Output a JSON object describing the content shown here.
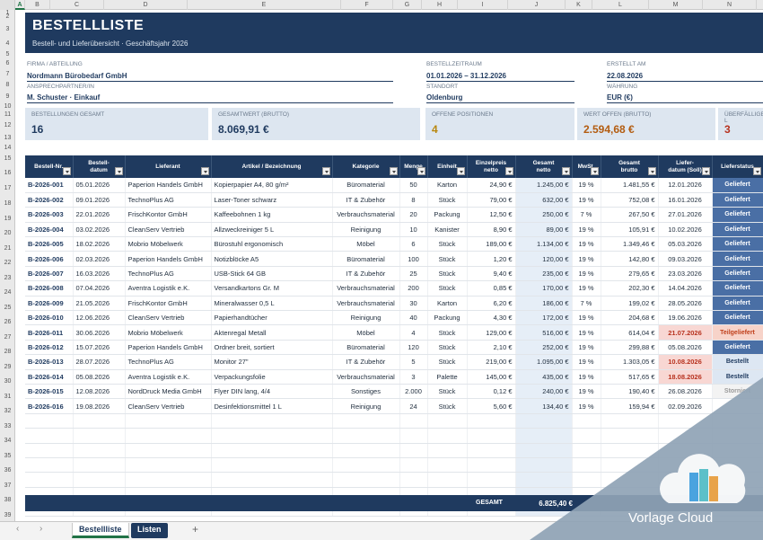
{
  "sheet": {
    "title": "BESTELLLISTE",
    "subtitle": "Bestell- und Lieferübersicht · Geschäftsjahr 2026"
  },
  "columns": [
    "A",
    "B",
    "C",
    "D",
    "E",
    "F",
    "G",
    "H",
    "I",
    "J",
    "K",
    "L",
    "M",
    "N"
  ],
  "rows": [
    "1",
    "2",
    "3",
    "4",
    "5",
    "6",
    "7",
    "8",
    "9",
    "10",
    "11",
    "12",
    "13",
    "14",
    "15",
    "16",
    "17",
    "18",
    "19",
    "20",
    "21",
    "22",
    "23",
    "24",
    "25",
    "26",
    "27",
    "28",
    "29",
    "30",
    "31",
    "32",
    "33",
    "34",
    "35",
    "36",
    "37",
    "38",
    "39"
  ],
  "info": {
    "firma_label": "FIRMA / ABTEILUNG",
    "firma": "Nordmann Bürobedarf GmbH",
    "ansprech_label": "ANSPRECHPARTNER/IN",
    "ansprech": "M. Schuster · Einkauf",
    "zeitraum_label": "BESTELLZEITRAUM",
    "zeitraum": "01.01.2026 – 31.12.2026",
    "standort_label": "STANDORT",
    "standort": "Oldenburg",
    "erstellt_label": "ERSTELLT AM",
    "erstellt": "22.08.2026",
    "waehrung_label": "WÄHRUNG",
    "waehrung": "EUR (€)"
  },
  "kpis": [
    {
      "label": "BESTELLUNGEN GESAMT",
      "value": "16",
      "color": "#1f3a5f"
    },
    {
      "label": "GESAMTWERT (BRUTTO)",
      "value": "8.069,91 €",
      "color": "#1f3a5f"
    },
    {
      "label": "OFFENE POSITIONEN",
      "value": "4",
      "color": "#b8860b"
    },
    {
      "label": "WERT OFFEN (BRUTTO)",
      "value": "2.594,68 €",
      "color": "#b35c10"
    },
    {
      "label": "ÜBERFÄLLIGE L",
      "value": "3",
      "color": "#b7321f"
    }
  ],
  "headers": [
    "Bestell-Nr.",
    "Bestell-\ndatum",
    "Lieferant",
    "Artikel / Bezeichnung",
    "Kategorie",
    "Menge",
    "Einheit",
    "Einzelpreis\nnetto",
    "Gesamt\nnetto",
    "MwSt.",
    "Gesamt\nbrutto",
    "Liefer-\ndatum (Soll)",
    "Lieferstatus"
  ],
  "orders": [
    [
      "B-2026-001",
      "05.01.2026",
      "Paperion Handels GmbH",
      "Kopierpapier A4, 80 g/m²",
      "Büromaterial",
      "50",
      "Karton",
      "24,90 €",
      "1.245,00 €",
      "19 %",
      "1.481,55 €",
      "12.01.2026",
      "Geliefert"
    ],
    [
      "B-2026-002",
      "09.01.2026",
      "TechnoPlus AG",
      "Laser-Toner schwarz",
      "IT & Zubehör",
      "8",
      "Stück",
      "79,00 €",
      "632,00 €",
      "19 %",
      "752,08 €",
      "16.01.2026",
      "Geliefert"
    ],
    [
      "B-2026-003",
      "22.01.2026",
      "FrischKontor GmbH",
      "Kaffeebohnen 1 kg",
      "Verbrauchsmaterial",
      "20",
      "Packung",
      "12,50 €",
      "250,00 €",
      "7 %",
      "267,50 €",
      "27.01.2026",
      "Geliefert"
    ],
    [
      "B-2026-004",
      "03.02.2026",
      "CleanServ Vertrieb",
      "Allzweckreiniger 5 L",
      "Reinigung",
      "10",
      "Kanister",
      "8,90 €",
      "89,00 €",
      "19 %",
      "105,91 €",
      "10.02.2026",
      "Geliefert"
    ],
    [
      "B-2026-005",
      "18.02.2026",
      "Mobrio Möbelwerk",
      "Bürostuhl ergonomisch",
      "Möbel",
      "6",
      "Stück",
      "189,00 €",
      "1.134,00 €",
      "19 %",
      "1.349,46 €",
      "05.03.2026",
      "Geliefert"
    ],
    [
      "B-2026-006",
      "02.03.2026",
      "Paperion Handels GmbH",
      "Notizblöcke A5",
      "Büromaterial",
      "100",
      "Stück",
      "1,20 €",
      "120,00 €",
      "19 %",
      "142,80 €",
      "09.03.2026",
      "Geliefert"
    ],
    [
      "B-2026-007",
      "16.03.2026",
      "TechnoPlus AG",
      "USB-Stick 64 GB",
      "IT & Zubehör",
      "25",
      "Stück",
      "9,40 €",
      "235,00 €",
      "19 %",
      "279,65 €",
      "23.03.2026",
      "Geliefert"
    ],
    [
      "B-2026-008",
      "07.04.2026",
      "Aventra Logistik e.K.",
      "Versandkartons Gr. M",
      "Verbrauchsmaterial",
      "200",
      "Stück",
      "0,85 €",
      "170,00 €",
      "19 %",
      "202,30 €",
      "14.04.2026",
      "Geliefert"
    ],
    [
      "B-2026-009",
      "21.05.2026",
      "FrischKontor GmbH",
      "Mineralwasser 0,5 L",
      "Verbrauchsmaterial",
      "30",
      "Karton",
      "6,20 €",
      "186,00 €",
      "7 %",
      "199,02 €",
      "28.05.2026",
      "Geliefert"
    ],
    [
      "B-2026-010",
      "12.06.2026",
      "CleanServ Vertrieb",
      "Papierhandtücher",
      "Reinigung",
      "40",
      "Packung",
      "4,30 €",
      "172,00 €",
      "19 %",
      "204,68 €",
      "19.06.2026",
      "Geliefert"
    ],
    [
      "B-2026-011",
      "30.06.2026",
      "Mobrio Möbelwerk",
      "Aktenregal Metall",
      "Möbel",
      "4",
      "Stück",
      "129,00 €",
      "516,00 €",
      "19 %",
      "614,04 €",
      "21.07.2026",
      "Teilgeliefert"
    ],
    [
      "B-2026-012",
      "15.07.2026",
      "Paperion Handels GmbH",
      "Ordner breit, sortiert",
      "Büromaterial",
      "120",
      "Stück",
      "2,10 €",
      "252,00 €",
      "19 %",
      "299,88 €",
      "05.08.2026",
      "Geliefert"
    ],
    [
      "B-2026-013",
      "28.07.2026",
      "TechnoPlus AG",
      "Monitor 27\"",
      "IT & Zubehör",
      "5",
      "Stück",
      "219,00 €",
      "1.095,00 €",
      "19 %",
      "1.303,05 €",
      "10.08.2026",
      "Bestellt"
    ],
    [
      "B-2026-014",
      "05.08.2026",
      "Aventra Logistik e.K.",
      "Verpackungsfolie",
      "Verbrauchsmaterial",
      "3",
      "Palette",
      "145,00 €",
      "435,00 €",
      "19 %",
      "517,65 €",
      "18.08.2026",
      "Bestellt"
    ],
    [
      "B-2026-015",
      "12.08.2026",
      "NordDruck Media GmbH",
      "Flyer DIN lang, 4/4",
      "Sonstiges",
      "2.000",
      "Stück",
      "0,12 €",
      "240,00 €",
      "19 %",
      "190,40 €",
      "26.08.2026",
      "Storniert"
    ],
    [
      "B-2026-016",
      "19.08.2026",
      "CleanServ Vertrieb",
      "Desinfektionsmittel 1 L",
      "Reinigung",
      "24",
      "Stück",
      "5,60 €",
      "134,40 €",
      "19 %",
      "159,94 €",
      "02.09.2026",
      ""
    ]
  ],
  "late_rows": [
    10,
    12,
    13
  ],
  "summary": {
    "label": "GESAMT",
    "value": "6.825,40 €"
  },
  "tabs": [
    "Bestellliste",
    "Listen"
  ],
  "watermark": "Vorlage Cloud"
}
